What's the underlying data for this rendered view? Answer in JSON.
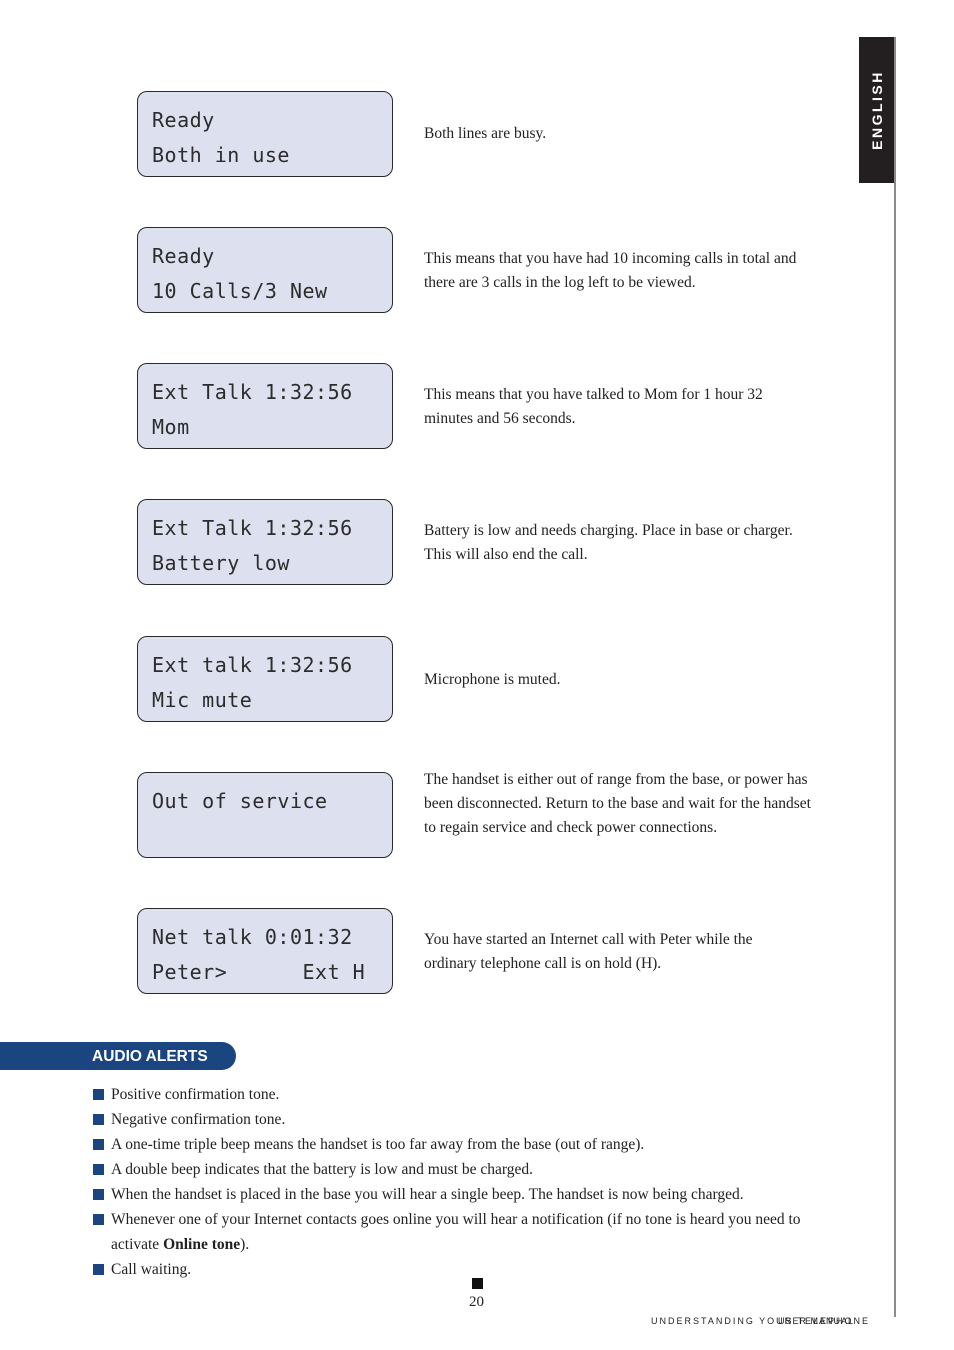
{
  "side_tab": {
    "label": "ENGLISH"
  },
  "displays": [
    {
      "line1": "Ready",
      "line2": "Both in use",
      "description": "Both lines are busy."
    },
    {
      "line1": "Ready",
      "line2": "10 Calls/3 New",
      "description": "This means that you have had 10 incoming calls in total and there are 3 calls in the log left to be viewed."
    },
    {
      "line1": "Ext Talk 1:32:56",
      "line2": "Mom",
      "description": "This means that you have talked to Mom for 1 hour 32 minutes and 56 seconds."
    },
    {
      "line1": "Ext Talk 1:32:56",
      "line2": "Battery low",
      "description": "Battery is low and needs charging. Place in base or charger. This will also end the call."
    },
    {
      "line1": "Ext talk 1:32:56",
      "line2": "Mic mute",
      "description": "Microphone is muted."
    },
    {
      "line1": "Out of service",
      "line2": "",
      "description": "The handset is either out of range from the base, or power has been disconnected. Return to the base and wait for the handset to regain service and check power connections."
    },
    {
      "line1": "Net talk 0:01:32",
      "line2": "Peter>      Ext H",
      "description": "You have started an Internet call with Peter while the ordinary telephone call is on hold (H)."
    }
  ],
  "audio_alerts": {
    "title": "AUDIO ALERTS",
    "items": [
      {
        "text": "Positive confirmation tone."
      },
      {
        "text": "Negative confirmation tone."
      },
      {
        "text": "A one-time triple beep means the handset is too far away from the base (out of range)."
      },
      {
        "text": "A double beep indicates that the battery is low and must be charged."
      },
      {
        "text": "When the handset is placed in the base you will hear a single beep. The handset is now being charged."
      },
      {
        "text": "Whenever one of your Internet contacts goes online you will hear a notification (if no tone is heard you need to activate ",
        "bold": "Online tone",
        "after": ")."
      },
      {
        "text": "Call waiting."
      }
    ]
  },
  "footer": {
    "page_number": "20",
    "section_text": "UNDERSTANDING YOUR TELEPHONE",
    "manual_text": "USER MANUAL"
  },
  "colors": {
    "accent": "#1b4580",
    "lcd_bg": "#dde0ee",
    "tab_bg": "#231f20"
  }
}
